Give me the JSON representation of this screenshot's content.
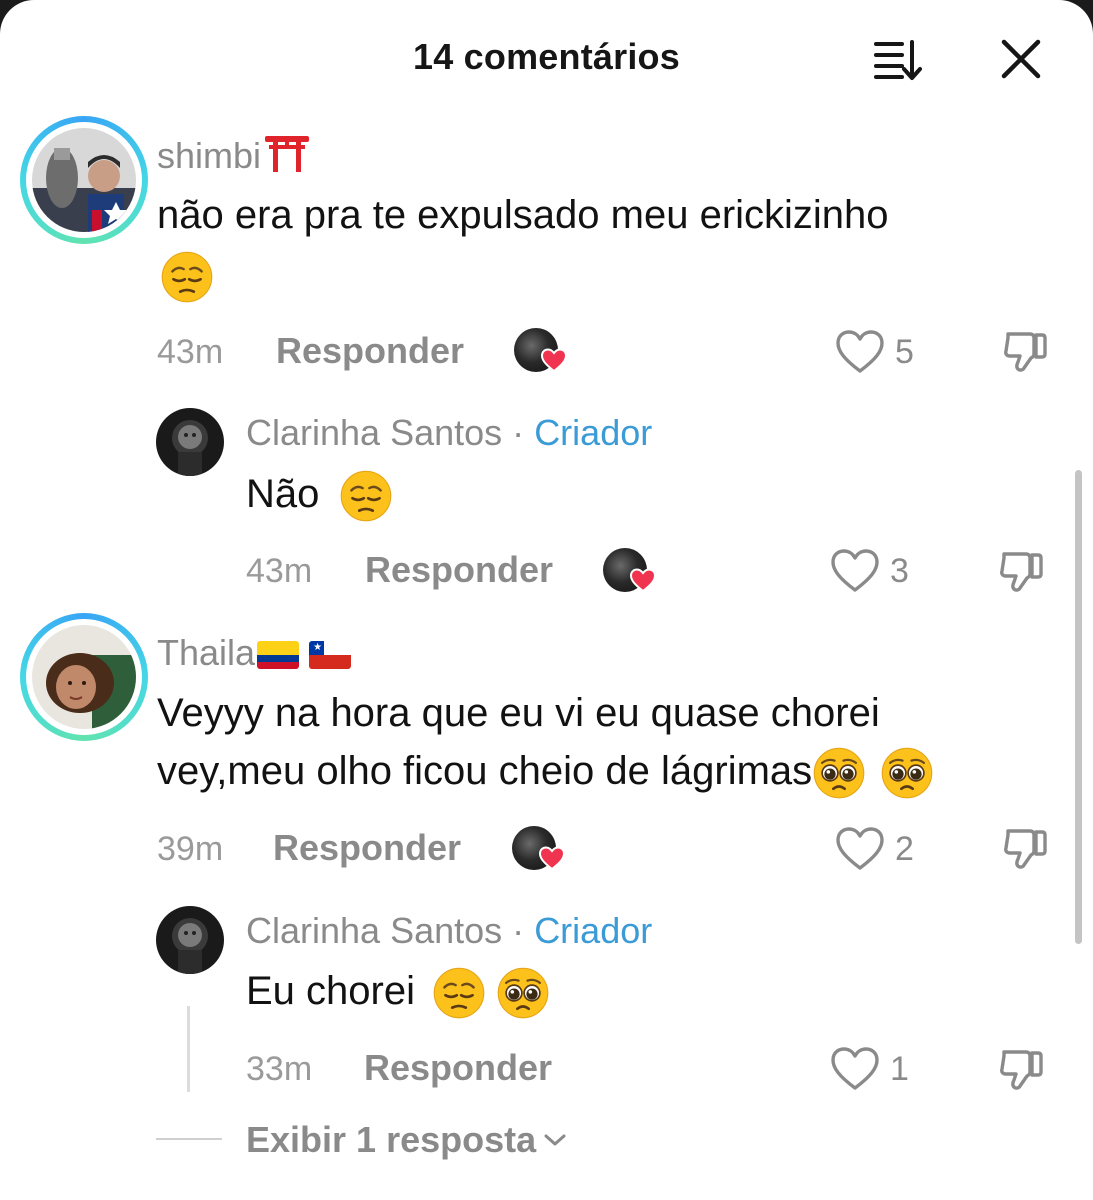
{
  "header": {
    "title": "14 comentários"
  },
  "comments": [
    {
      "username": "shimbi",
      "text_line1": "não era pra te expulsado meu erickizinho",
      "time": "43m",
      "reply_label": "Responder",
      "likes": "5",
      "reply": {
        "username": "Clarinha Santos",
        "separator": "·",
        "creator_label": "Criador",
        "text": "Não",
        "time": "43m",
        "reply_label": "Responder",
        "likes": "3"
      }
    },
    {
      "username": "Thaila",
      "text_line1": "Veyyy na hora que eu vi eu quase chorei",
      "text_line2": "vey,meu olho ficou cheio de lágrimas",
      "time": "39m",
      "reply_label": "Responder",
      "likes": "2",
      "reply": {
        "username": "Clarinha Santos",
        "separator": "·",
        "creator_label": "Criador",
        "text": "Eu chorei",
        "time": "33m",
        "reply_label": "Responder",
        "likes": "1"
      },
      "view_more": "Exibir 1 resposta"
    }
  ],
  "colors": {
    "creator": "#3a9bd6",
    "heart": "#f0344f",
    "muted": "#8a8a8a"
  },
  "icons": [
    "sort-icon",
    "close-icon",
    "heart-outline-icon",
    "dislike-icon",
    "creator-liked-heart-icon",
    "chevron-down-icon",
    "torii-gate-emoji",
    "pensive-emoji",
    "pleading-emoji",
    "colombia-flag",
    "chile-flag"
  ]
}
